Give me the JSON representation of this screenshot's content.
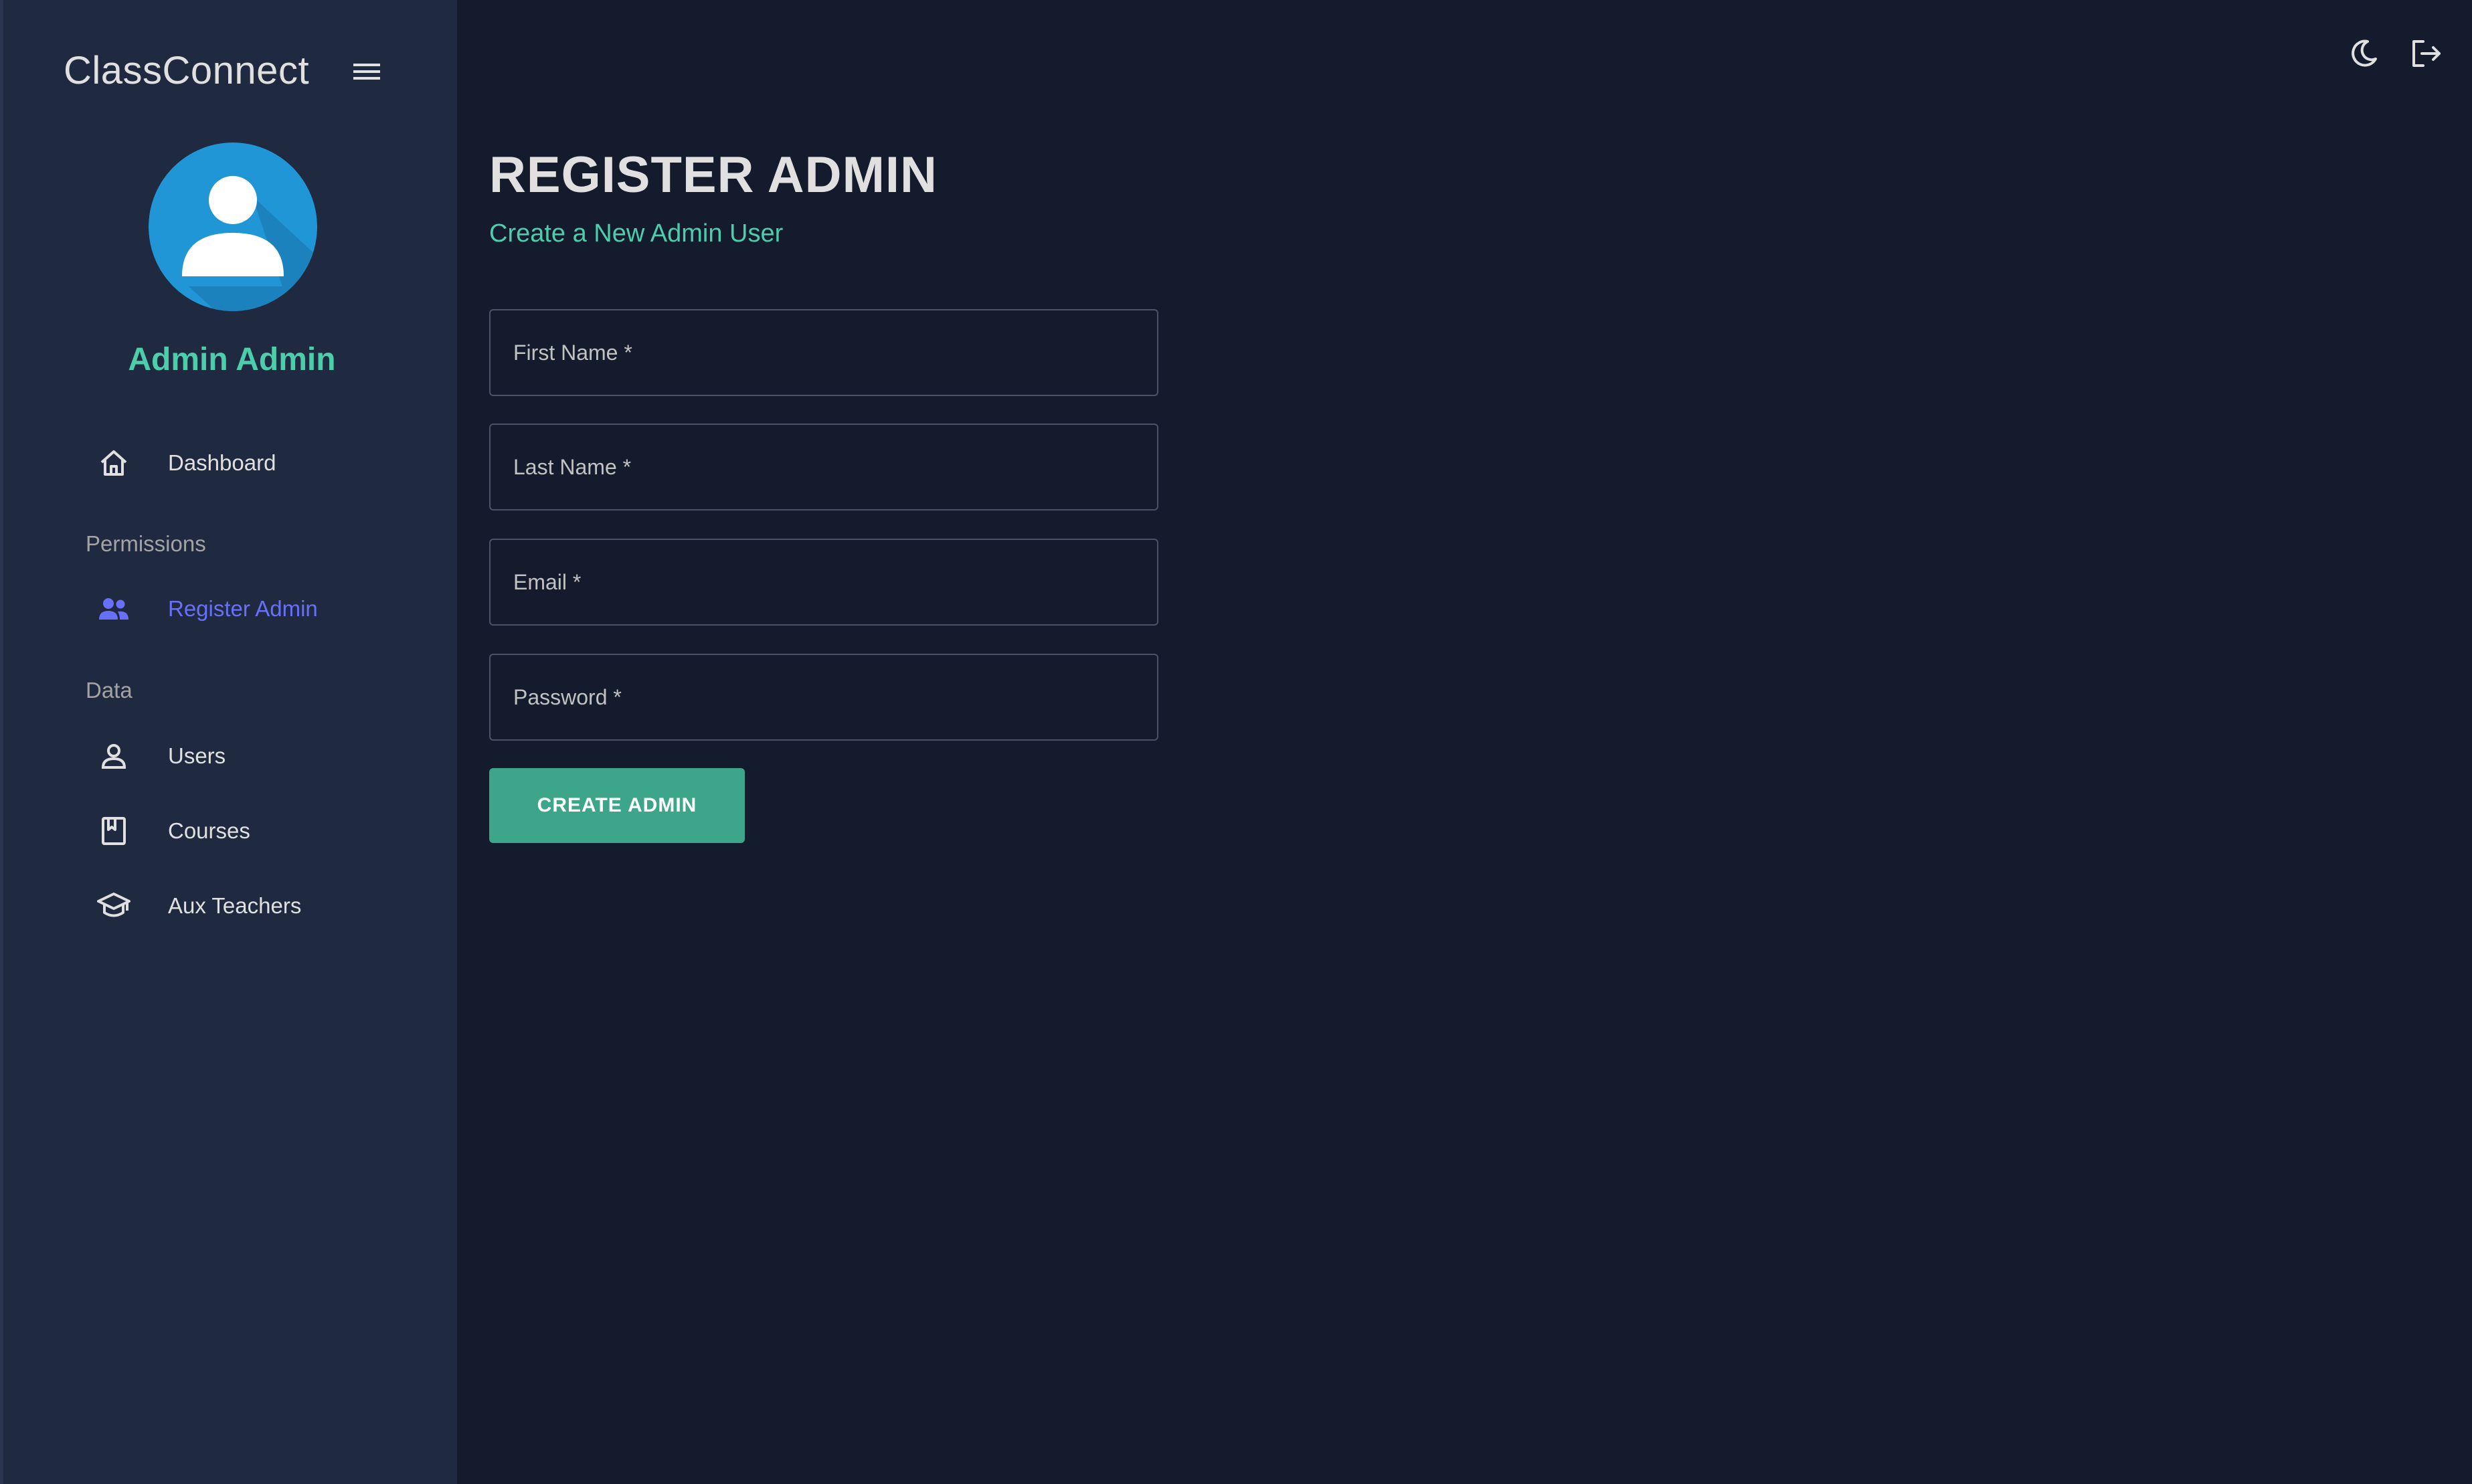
{
  "sidebar": {
    "brand": "ClassConnect",
    "profile_name": "Admin Admin",
    "nav": {
      "dashboard": "Dashboard",
      "permissions_section": "Permissions",
      "register_admin": "Register Admin",
      "data_section": "Data",
      "users": "Users",
      "courses": "Courses",
      "aux_teachers": "Aux Teachers"
    },
    "active_item": "register_admin"
  },
  "header": {
    "icons": [
      "moon-icon",
      "logout-icon"
    ]
  },
  "page": {
    "title": "REGISTER ADMIN",
    "subtitle": "Create a New Admin User"
  },
  "form": {
    "first_name": "First Name *",
    "last_name": "Last Name *",
    "email": "Email *",
    "password": "Password *",
    "submit_label": "CREATE ADMIN"
  },
  "colors": {
    "background": "#141b2d",
    "sidebar": "#1f2a40",
    "accent_green": "#4cceac",
    "button_green": "#3da58a",
    "active_nav": "#6870fa",
    "avatar_blue": "#2196d6"
  }
}
